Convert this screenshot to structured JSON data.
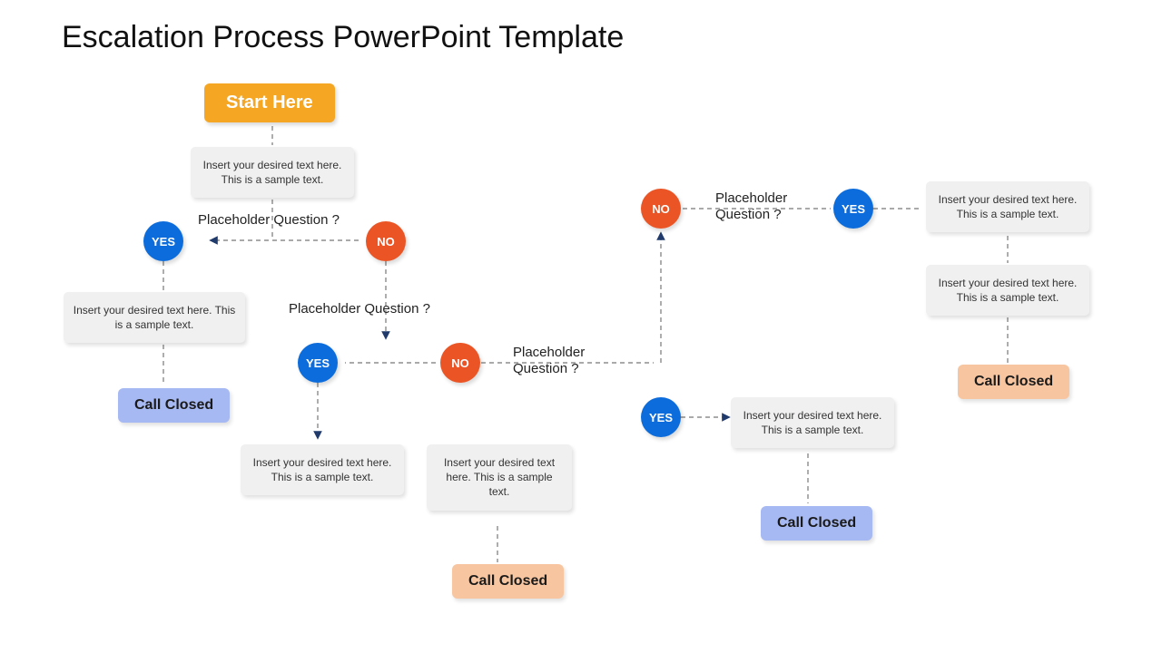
{
  "title": "Escalation Process PowerPoint Template",
  "start": "Start Here",
  "placeholder": "Insert your desired text here. This is a sample text.",
  "placeholder_short": "Insert your desired text here. This is a sample text.",
  "question": "Placeholder Question ?",
  "question_split1": "Placeholder",
  "question_split2": "Question ?",
  "yes": "YES",
  "no": "NO",
  "call_closed": "Call Closed"
}
